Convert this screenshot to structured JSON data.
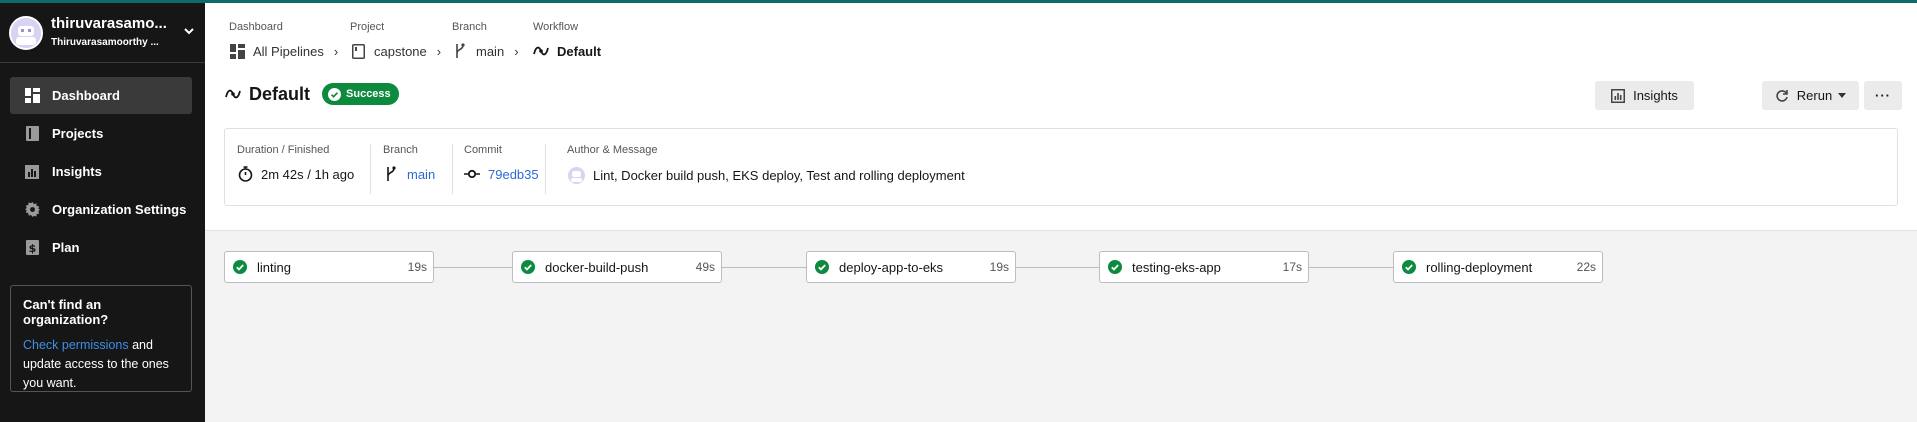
{
  "colors": {
    "sidebar_bg": "#161616",
    "success": "#0c8a3e",
    "link": "#2b6ad6",
    "accent_line": "#0d6b6b"
  },
  "sidebar": {
    "org_name": "thiruvarasamo...",
    "org_sub": "Thiruvarasamoorthy ...",
    "items": [
      {
        "label": "Dashboard",
        "icon": "dashboard-icon",
        "active": true
      },
      {
        "label": "Projects",
        "icon": "book-icon"
      },
      {
        "label": "Insights",
        "icon": "bar-chart-icon"
      },
      {
        "label": "Organization Settings",
        "icon": "gear-icon"
      },
      {
        "label": "Plan",
        "icon": "dollar-icon"
      }
    ],
    "help": {
      "title": "Can't find an organization?",
      "link": "Check permissions",
      "text_after_link": " and update access to the ones you want."
    }
  },
  "breadcrumbs": [
    {
      "label": "Dashboard",
      "value": "All Pipelines",
      "icon": "pipelines-icon"
    },
    {
      "label": "Project",
      "value": "capstone",
      "icon": "project-icon"
    },
    {
      "label": "Branch",
      "value": "main",
      "icon": "branch-icon"
    },
    {
      "label": "Workflow",
      "value": "Default",
      "icon": "workflow-icon"
    }
  ],
  "workflow": {
    "title": "Default",
    "status": "Success"
  },
  "actions": {
    "insights": "Insights",
    "rerun": "Rerun",
    "more": "···"
  },
  "info": {
    "duration_label": "Duration / Finished",
    "duration_value": "2m 42s / 1h ago",
    "branch_label": "Branch",
    "branch_value": "main",
    "commit_label": "Commit",
    "commit_value": "79edb35",
    "author_label": "Author & Message",
    "message": "Lint, Docker build push, EKS deploy, Test and rolling deployment"
  },
  "jobs": [
    {
      "name": "linting",
      "duration": "19s",
      "status": "success"
    },
    {
      "name": "docker-build-push",
      "duration": "49s",
      "status": "success"
    },
    {
      "name": "deploy-app-to-eks",
      "duration": "19s",
      "status": "success"
    },
    {
      "name": "testing-eks-app",
      "duration": "17s",
      "status": "success"
    },
    {
      "name": "rolling-deployment",
      "duration": "22s",
      "status": "success"
    }
  ]
}
